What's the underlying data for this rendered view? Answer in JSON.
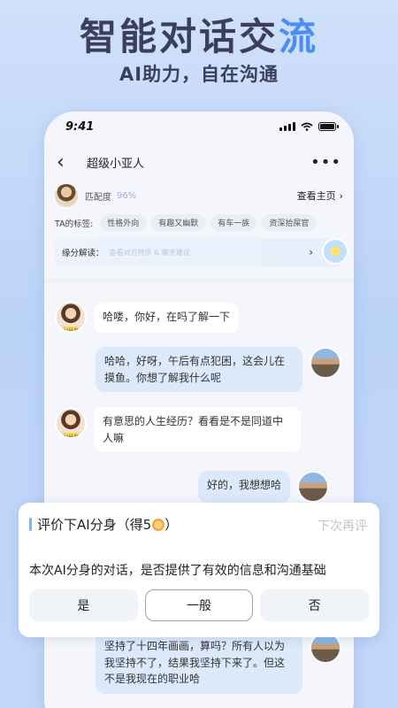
{
  "promo": {
    "headline_main": "智能对话交",
    "headline_accent": "流",
    "subline": "AI助力，自在沟通"
  },
  "status_bar": {
    "time": "9:41"
  },
  "nav": {
    "title": "超级小亚人"
  },
  "profile": {
    "match_label": "匹配度",
    "match_value": "96%",
    "homepage_label": "查看主页",
    "tags_label": "TA的标签:",
    "tags": [
      "性格外向",
      "有趣又幽默",
      "有车一族",
      "资深拾屎官"
    ],
    "analysis_label": "缘分解读：",
    "analysis_hint": "查看对方特质 & 聊天建议"
  },
  "messages": [
    {
      "side": "left",
      "text": "哈喽，你好，在吗了解一下"
    },
    {
      "side": "right",
      "text": "哈哈，好呀，午后有点犯困，这会儿在摸鱼。你想了解我什么呢"
    },
    {
      "side": "left",
      "text": "有意思的人生经历？看看是不是同道中人嘛"
    },
    {
      "side": "right",
      "text": "好的，我想想哈"
    },
    {
      "side": "right",
      "text": "坚持了十四年画画，算吗？所有人以为我坚持不了，结果我坚持下来了。但这不是我现在的职业哈"
    }
  ],
  "rating_popup": {
    "title": "评价下AI分身（得5",
    "title_end": "）",
    "later": "下次再评",
    "question": "本次AI分身的对话，是否提供了有效的信息和沟通基础",
    "options": [
      "是",
      "一般",
      "否"
    ],
    "selected_index": 1
  }
}
